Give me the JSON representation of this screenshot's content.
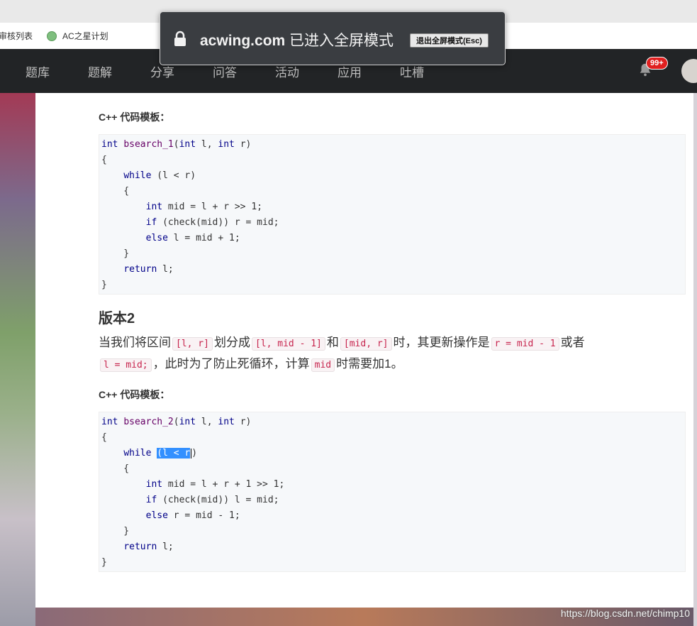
{
  "browser": {
    "bookmarks": [
      {
        "label": "审核列表"
      },
      {
        "label": "AC之星计划"
      }
    ]
  },
  "nav": {
    "items": [
      "题库",
      "题解",
      "分享",
      "问答",
      "活动",
      "应用",
      "吐槽"
    ],
    "notification_badge": "99+"
  },
  "toast": {
    "domain": "acwing.com",
    "message": " 已进入全屏模式",
    "exit_button": "退出全屏模式(Esc)"
  },
  "article": {
    "template_label_1": "C++ 代码模板：",
    "code_1": [
      "int bsearch_1(int l, int r)",
      "{",
      "    while (l < r)",
      "    {",
      "        int mid = l + r >> 1;",
      "        if (check(mid)) r = mid;",
      "        else l = mid + 1;",
      "    }",
      "    return l;",
      "}"
    ],
    "heading_2": "版本2",
    "para": {
      "t1": "当我们将区间",
      "c1": "[l, r]",
      "t2": "划分成",
      "c2": "[l, mid - 1]",
      "t3": "和",
      "c3": "[mid, r]",
      "t4": "时，其更新操作是",
      "c4": "r = mid - 1",
      "t5": "或者",
      "c5": "l = mid;",
      "t6": "，此时为了防止死循环，计算",
      "c6": "mid",
      "t7": "时需要加1。"
    },
    "template_label_2": "C++ 代码模板：",
    "code_2": [
      "int bsearch_2(int l, int r)",
      "{",
      "    while (l < r)",
      "    {",
      "        int mid = l + r + 1 >> 1;",
      "        if (check(mid)) l = mid;",
      "        else r = mid - 1;",
      "    }",
      "    return l;",
      "}"
    ],
    "selected_text": "(l < r"
  },
  "watermark": "https://blog.csdn.net/chimp10"
}
